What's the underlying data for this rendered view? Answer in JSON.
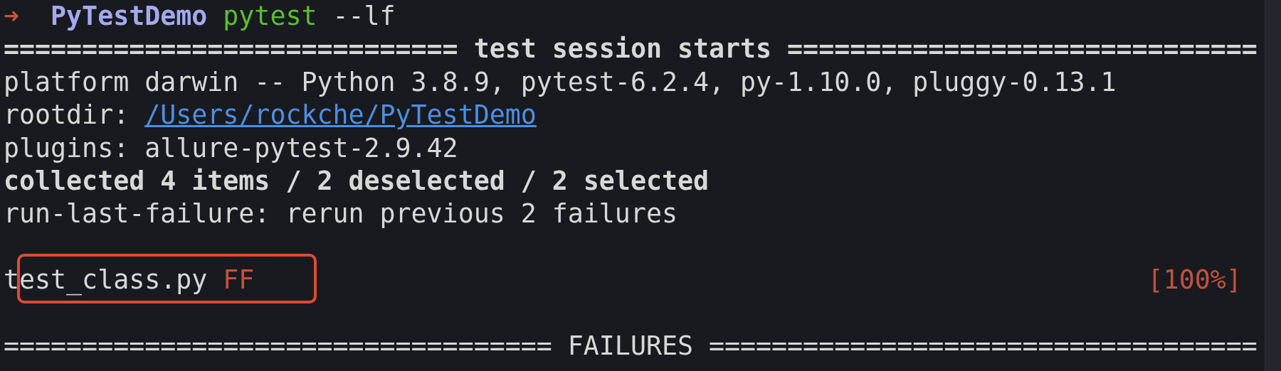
{
  "prompt": {
    "arrow": "➜",
    "directory": "PyTestDemo",
    "command": "pytest",
    "args": "--lf"
  },
  "lines": [
    {
      "kind": "text",
      "bold": true,
      "text": "============================= test session starts =============================="
    },
    {
      "kind": "text",
      "bold": false,
      "text": "platform darwin -- Python 3.8.9, pytest-6.2.4, py-1.10.0, pluggy-0.13.1"
    },
    {
      "kind": "link",
      "label": "rootdir:",
      "link": "/Users/rockche/PyTestDemo"
    },
    {
      "kind": "text",
      "bold": false,
      "text": "plugins: allure-pytest-2.9.42"
    },
    {
      "kind": "text",
      "bold": true,
      "text": "collected 4 items / 2 deselected / 2 selected"
    },
    {
      "kind": "text",
      "bold": false,
      "text": "run-last-failure: rerun previous 2 failures"
    },
    {
      "kind": "blank"
    },
    {
      "kind": "progress",
      "file": "test_class.py",
      "result": "FF",
      "percent": "[100%]",
      "highlighted": true
    },
    {
      "kind": "blank"
    },
    {
      "kind": "text",
      "bold": false,
      "text": "=================================== FAILURES ==================================="
    }
  ]
}
